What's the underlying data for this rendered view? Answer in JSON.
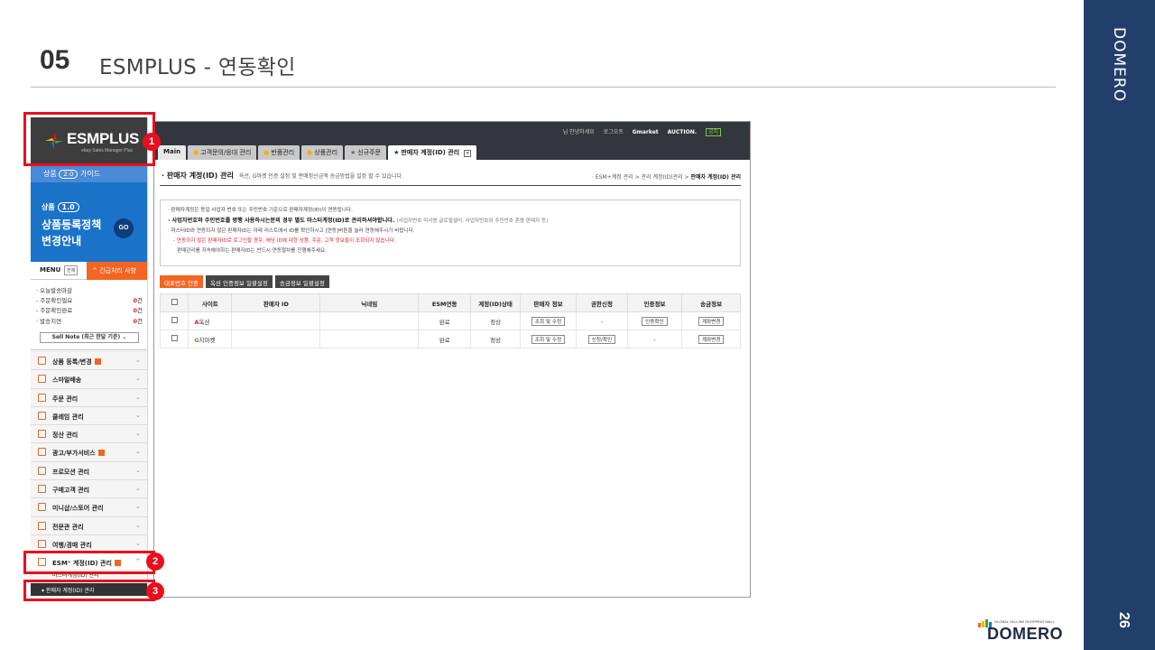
{
  "slide": {
    "number": "05",
    "title": "ESMPLUS - 연동확인",
    "side_brand": "DOMERO",
    "page": "26",
    "footer_logo": {
      "tagline": "GLOBAL ON-LINE SHOPPING MALL",
      "name": "DOMERO"
    }
  },
  "left_nav": {
    "logo": {
      "text": "ESMPLUS",
      "sub": "ebay Sales Manager Plus"
    },
    "guide": {
      "prefix": "상품",
      "version": "2.0",
      "suffix": "가이드"
    },
    "banner": {
      "prefix": "상품",
      "version": "1.0",
      "line1": "상품등록정책",
      "line2": "변경안내",
      "go": "GO"
    },
    "menu": {
      "label": "MENU",
      "all": "전체",
      "urgent": "^ 긴급처리 사항"
    },
    "status": [
      {
        "label": "· 오늘발송마감",
        "count": ""
      },
      {
        "label": "- 주문확인필요",
        "count": "0",
        "unit": "건"
      },
      {
        "label": "- 주문확인완료",
        "count": "0",
        "unit": "건"
      },
      {
        "label": "· 발송지연",
        "count": "0",
        "unit": "건"
      }
    ],
    "sell_note": "Sell Note (최근 한달 기준) ⌄",
    "items": [
      {
        "label": "상품 등록/변경",
        "new": true
      },
      {
        "label": "스마일배송",
        "new": false
      },
      {
        "label": "주문 관리",
        "new": false
      },
      {
        "label": "클레임 관리",
        "new": false
      },
      {
        "label": "정산 관리",
        "new": false
      },
      {
        "label": "광고/부가서비스",
        "new": true
      },
      {
        "label": "프로모션 관리",
        "new": false
      },
      {
        "label": "구매고객 관리",
        "new": false
      },
      {
        "label": "미니샵/스토어 관리",
        "new": false
      },
      {
        "label": "전문관 관리",
        "new": false
      },
      {
        "label": "여행/경매 관리",
        "new": false
      },
      {
        "label": "ESM⁺ 계정(ID) 관리",
        "new": true,
        "chev": "^"
      }
    ],
    "sub_item_master": "마스터계정(ID) 관리",
    "sub_item_seller": "▾  판매자 계정(ID) 관리"
  },
  "top": {
    "util": [
      "님 안녕하세요",
      "로그오프",
      "Gmarket",
      "AUCTION.",
      "공지"
    ],
    "tabs": [
      {
        "label": "Main",
        "star": false,
        "active": false
      },
      {
        "label": "고객문의/응대 관리",
        "star": true,
        "active": false
      },
      {
        "label": "반품관리",
        "star": true,
        "active": false
      },
      {
        "label": "상품관리",
        "star": true,
        "active": false
      },
      {
        "label": "신규주문",
        "star": true,
        "active": false
      },
      {
        "label": "판매자 계정(ID) 관리",
        "star": true,
        "active": true
      }
    ],
    "tab_close": "✕"
  },
  "page": {
    "title": "· 판매자 계정(ID) 관리",
    "description": "옥션, G마켓 인증 설정 및 판매정산금액 송금방법을 설정 할 수 있습니다.",
    "breadcrumb_pre": "· ESM+계정 관리 > 관리 계정(ID)관리 > ",
    "breadcrumb_cur": "판매자 계정(ID) 관리",
    "notice": {
      "line1": "· 판매자계정은 동일 사업자 번호 또는 주민번호 기준으로 판매자계정(ID)이 연동됩니다.",
      "line2": "· 사업자번호와 주민번호를 병행 사용하시는분의 경우 별도 마스터계정(ID)로 관리하셔야합니다.",
      "line2_light": "(사업자번호 미사용 글로벌셀러, 사업자번호와 주민번호 혼용 판매자 등)",
      "line3": "· 마스터ID와 연동되지 않은 판매자ID는 아래 리스트에서 ID를 확인하시고 [연동]버튼을 눌러 연동해주시기 바랍니다.",
      "line4": "- 연동하지 않은 판매자ID로 로그인할 경우, 해당 ID에 대한 상품, 주문, 고객 정보들이 조회되지 않습니다.",
      "line5": "판매관리를 지속해야하는 판매자ID는 반드시 연동절차를 진행해주세요."
    },
    "buttons": [
      "대표번호 인증",
      "옥션 인증정보 일괄설정",
      "송금정보 일괄설정"
    ],
    "table": {
      "headers": [
        "",
        "사이트",
        "판매자 ID",
        "닉네임",
        "ESM연동",
        "계정(ID)상태",
        "판매자 정보",
        "권한신청",
        "인증정보",
        "송금정보"
      ],
      "rows": [
        {
          "site_letter": "A",
          "site_rest": "옥션",
          "seller_id": "",
          "nickname": "",
          "linked": "완료",
          "status": "정상",
          "seller_info": "조회 및 수정",
          "permission": "-",
          "auth": "인증확인",
          "remit": "계좌변경"
        },
        {
          "site_letter": "G",
          "site_rest": "지마켓",
          "seller_id": "",
          "nickname": "",
          "linked": "완료",
          "status": "정상",
          "seller_info": "조회 및 수정",
          "permission": "신청/확인",
          "auth": "-",
          "remit": "계좌변경"
        }
      ]
    }
  },
  "annotations": [
    "1",
    "2",
    "3"
  ],
  "colors": {
    "band": "#223f6c",
    "callout": "#e8101e",
    "accent_orange": "#f26522",
    "banner_blue": "#1a73c9"
  }
}
